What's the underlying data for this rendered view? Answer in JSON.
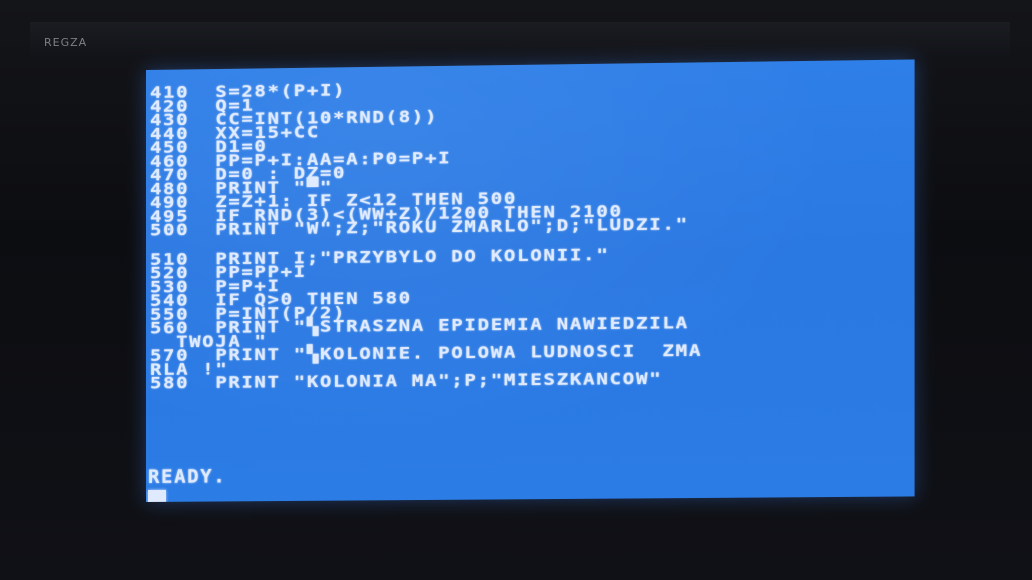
{
  "tv": {
    "brand": "REGZA"
  },
  "colors": {
    "screen_background": "#2c7ce6",
    "text": "#dfeaff"
  },
  "listing": [
    "410  S=28*(P+I)",
    "420  Q=1",
    "430  CC=INT(10*RND(8))",
    "440  XX=15+CC",
    "450  D1=0",
    "460  PP=P+I:AA=A:P0=P+I",
    "470  D=0 : DZ=0",
    "480  PRINT \"▀\"",
    "490  Z=Z+1: IF Z<12 THEN 500",
    "495  IF RND(3)<(WW+Z)/1200 THEN 2100",
    "500  PRINT \"W\";Z;\"ROKU ZMARLO\";D;\"LUDZI.\"",
    "",
    "510  PRINT I;\"PRZYBYLO DO KOLONII.\"",
    "520  PP=PP+I",
    "530  P=P+I",
    "540  IF Q>0 THEN 580",
    "550  P=INT(P/2)",
    "560  PRINT \"▚STRASZNA EPIDEMIA NAWIEDZILA",
    "  TWOJA \"",
    "570  PRINT \"▚KOLONIE. POLOWA LUDNOSCI  ZMA",
    "RLA !\"",
    "580  PRINT \"KOLONIA MA\";P;\"MIESZKANCOW\""
  ],
  "status": "READY."
}
